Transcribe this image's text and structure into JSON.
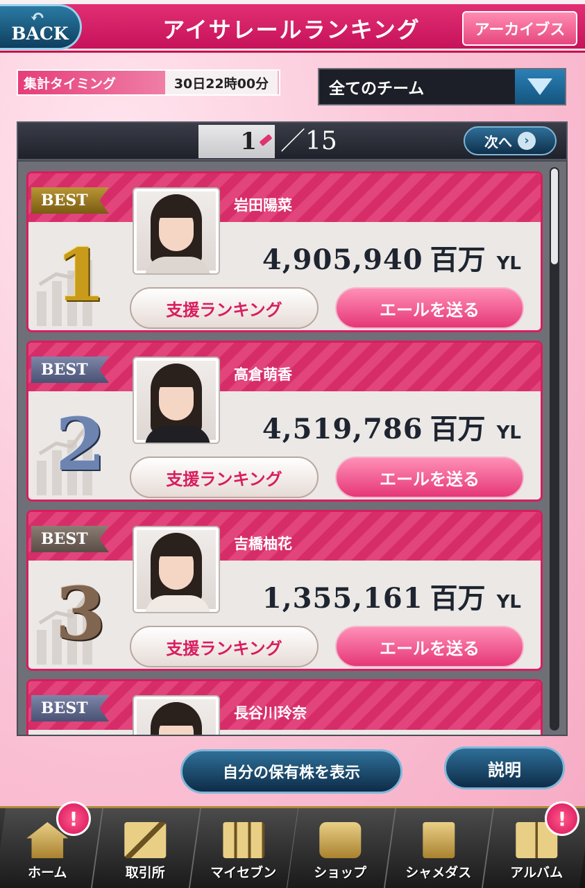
{
  "header": {
    "back_label": "BACK",
    "title": "アイサレールランキング",
    "archive_label": "アーカイブス"
  },
  "timing": {
    "label": "集計タイミング",
    "value": "30日22時00分"
  },
  "team_filter": {
    "selected": "全てのチーム"
  },
  "pager": {
    "current_page": "1",
    "total": "／15",
    "next_label": "次へ"
  },
  "ranking": [
    {
      "badge": "BEST",
      "rank": "1",
      "name": "岩田陽菜",
      "amount": "4,905,940",
      "unit": "百万",
      "currency": "YL",
      "support_label": "支援ランキング",
      "cheer_label": "エールを送る"
    },
    {
      "badge": "BEST",
      "rank": "2",
      "name": "高倉萌香",
      "amount": "4,519,786",
      "unit": "百万",
      "currency": "YL",
      "support_label": "支援ランキング",
      "cheer_label": "エールを送る"
    },
    {
      "badge": "BEST",
      "rank": "3",
      "name": "吉橋柚花",
      "amount": "1,355,161",
      "unit": "百万",
      "currency": "YL",
      "support_label": "支援ランキング",
      "cheer_label": "エールを送る"
    },
    {
      "badge": "BEST",
      "name": "長谷川玲奈"
    }
  ],
  "actions": {
    "holdings_label": "自分の保有株を表示",
    "help_label": "説明"
  },
  "bottom_nav": [
    {
      "label": "ホーム",
      "icon": "home-icon",
      "badge": "!"
    },
    {
      "label": "取引所",
      "icon": "chart-icon"
    },
    {
      "label": "マイセブン",
      "icon": "members-icon"
    },
    {
      "label": "ショップ",
      "icon": "shop-icon"
    },
    {
      "label": "シャメダス",
      "icon": "photo-card-icon"
    },
    {
      "label": "アルバム",
      "icon": "album-icon",
      "badge": "!"
    }
  ],
  "colors": {
    "accent": "#d81d5f",
    "nav_blue": "#2e6f98",
    "gold": "#c89c1a"
  }
}
